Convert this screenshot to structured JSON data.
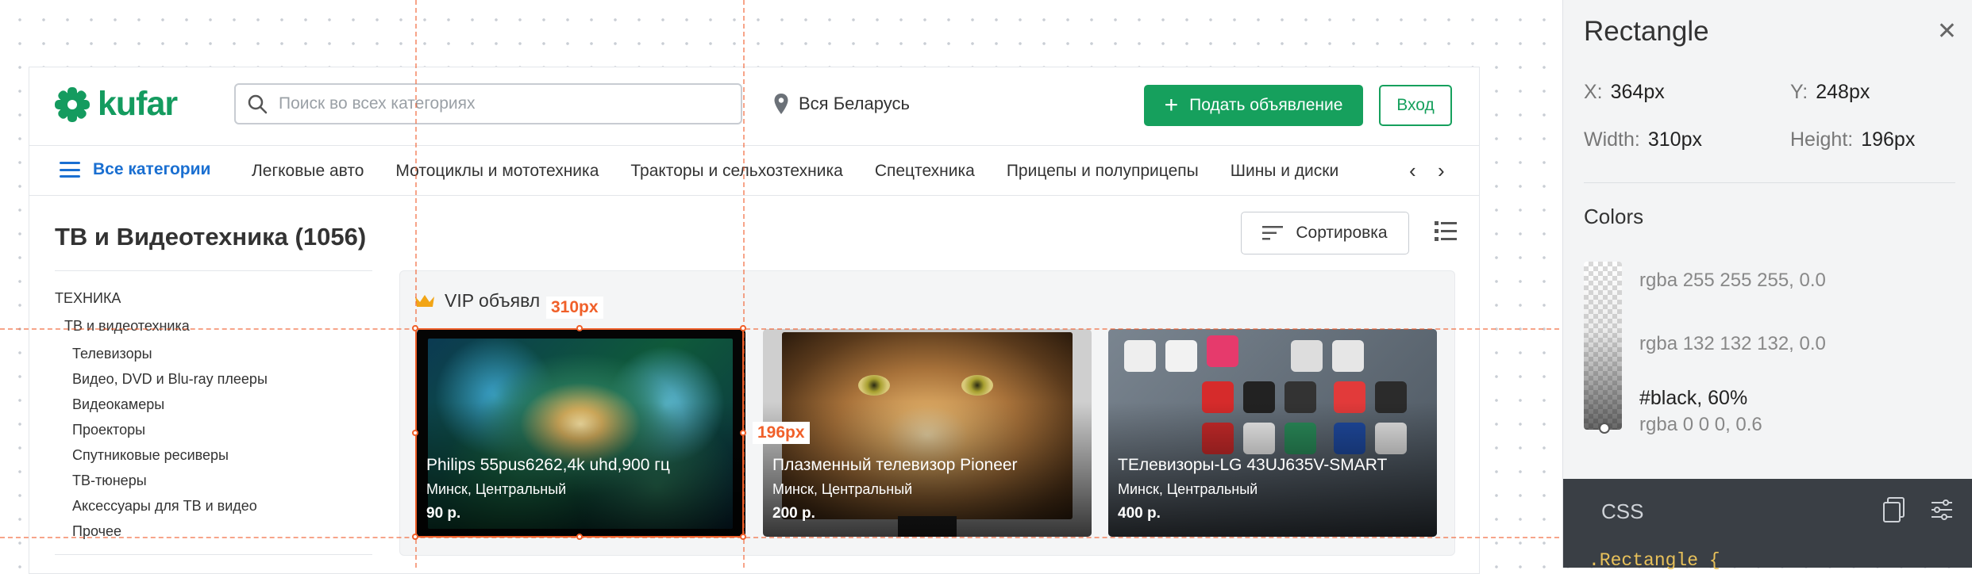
{
  "header": {
    "logo_text": "kufar",
    "search_placeholder": "Поиск во всех категориях",
    "region": "Вся Беларусь",
    "post_button": "Подать объявление",
    "login_button": "Вход"
  },
  "nav": {
    "all_categories": "Все категории",
    "items": [
      "Легковые авто",
      "Мотоциклы и мототехника",
      "Тракторы и сельхозтехника",
      "Спецтехника",
      "Прицепы и полуприцепы",
      "Шины и диски"
    ]
  },
  "page": {
    "title": "ТВ и Видеотехника (1056)",
    "sort_label": "Сортировка"
  },
  "sidebar": {
    "top_category": "ТЕХНИКА",
    "selected": "ТВ и видеотехника",
    "subcategories": [
      "Телевизоры",
      "Видео, DVD и Blu-ray плееры",
      "Видеокамеры",
      "Проекторы",
      "Спутниковые ресиверы",
      "ТВ-тюнеры",
      "Аксессуары для ТВ и видео",
      "Прочее"
    ]
  },
  "vip": {
    "heading": "VIP объявл",
    "cards": [
      {
        "title": "Philips 55pus6262,4k uhd,900 гц",
        "location": "Минск, Центральный",
        "price": "90 р."
      },
      {
        "title": "Плазменный телевизор Pioneer",
        "location": "Минск, Центральный",
        "price": "200 р."
      },
      {
        "title": "ТЕлевизоры-LG 43UJ635V-SMART",
        "location": "Минск, Центральный",
        "price": "400 р."
      }
    ]
  },
  "overlay": {
    "width_label": "310px",
    "height_label": "196px"
  },
  "inspector": {
    "title": "Rectangle",
    "x_label": "X:",
    "x_value": "364px",
    "y_label": "Y:",
    "y_value": "248px",
    "width_label": "Width:",
    "width_value": "310px",
    "height_label": "Height:",
    "height_value": "196px",
    "colors_title": "Colors",
    "colors": [
      "rgba 255 255 255, 0.0",
      "rgba 132 132 132, 0.0",
      "#black, 60%",
      "rgba 0 0 0, 0.6"
    ],
    "css_title": "CSS",
    "css_snippet": ".Rectangle {"
  },
  "theme": {
    "brand_green": "#16a05d",
    "link_blue": "#1a6fd1",
    "measure_orange": "#f0602a"
  }
}
